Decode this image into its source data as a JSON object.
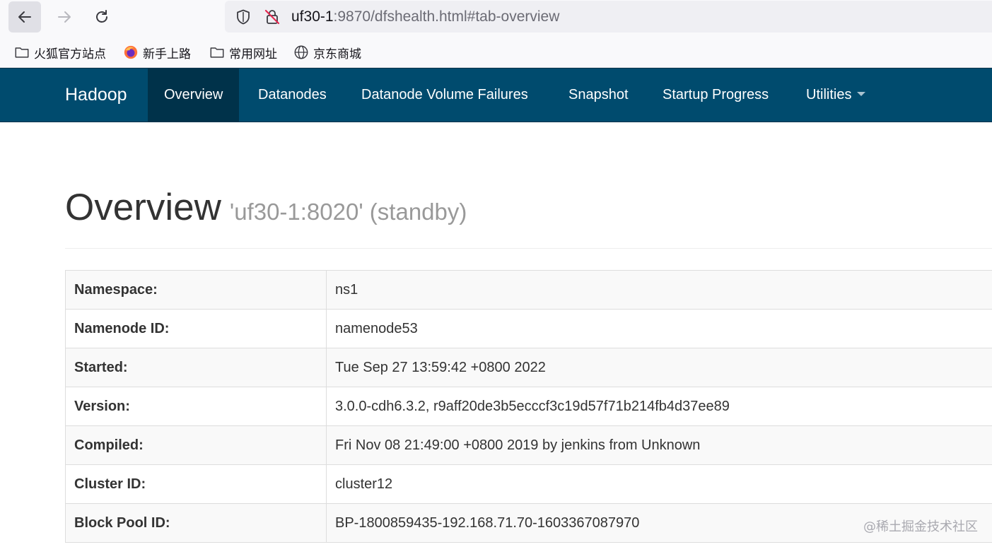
{
  "browser": {
    "url_host": "uf30-1",
    "url_rest": ":9870/dfshealth.html#tab-overview",
    "bookmarks": [
      {
        "label": "火狐官方站点",
        "icon": "folder-icon"
      },
      {
        "label": "新手上路",
        "icon": "firefox-icon"
      },
      {
        "label": "常用网址",
        "icon": "folder-icon"
      },
      {
        "label": "京东商城",
        "icon": "globe-icon"
      }
    ]
  },
  "navbar": {
    "brand": "Hadoop",
    "items": [
      {
        "label": "Overview",
        "active": true
      },
      {
        "label": "Datanodes"
      },
      {
        "label": "Datanode Volume Failures"
      },
      {
        "label": "Snapshot"
      },
      {
        "label": "Startup Progress"
      },
      {
        "label": "Utilities",
        "dropdown": true
      }
    ],
    "colors": {
      "background": "#004b6e",
      "active": "#00324a"
    }
  },
  "page": {
    "title": "Overview",
    "subtitle": "'uf30-1:8020' (standby)"
  },
  "overview_table": [
    {
      "key": "Namespace:",
      "value": "ns1"
    },
    {
      "key": "Namenode ID:",
      "value": "namenode53"
    },
    {
      "key": "Started:",
      "value": "Tue Sep 27 13:59:42 +0800 2022"
    },
    {
      "key": "Version:",
      "value": "3.0.0-cdh6.3.2, r9aff20de3b5ecccf3c19d57f71b214fb4d37ee89"
    },
    {
      "key": "Compiled:",
      "value": "Fri Nov 08 21:49:00 +0800 2019 by jenkins from Unknown"
    },
    {
      "key": "Cluster ID:",
      "value": "cluster12"
    },
    {
      "key": "Block Pool ID:",
      "value": "BP-1800859435-192.168.71.70-1603367087970"
    }
  ],
  "watermark": "@稀土掘金技术社区"
}
